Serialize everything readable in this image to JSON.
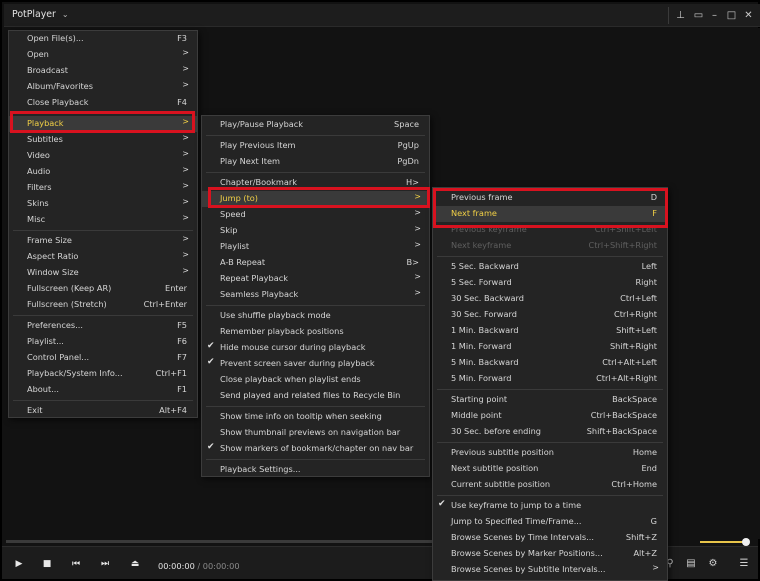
{
  "app": {
    "title": "PotPlayer"
  },
  "time": {
    "current": "00:00:00",
    "separator": "/",
    "total": "00:00:00"
  },
  "menu_main": [
    {
      "label": "Open File(s)...",
      "shortcut": "F3",
      "top": 0
    },
    {
      "label": "Open",
      "arrow": true
    },
    {
      "label": "Broadcast",
      "arrow": true
    },
    {
      "label": "Album/Favorites",
      "arrow": true
    },
    {
      "label": "Close Playback",
      "shortcut": "F4"
    },
    {
      "sep": true
    },
    {
      "label": "Playback",
      "arrow": true,
      "highlight": true
    },
    {
      "label": "Subtitles",
      "arrow": true
    },
    {
      "label": "Video",
      "arrow": true
    },
    {
      "label": "Audio",
      "arrow": true
    },
    {
      "label": "Filters",
      "arrow": true
    },
    {
      "label": "Skins",
      "arrow": true
    },
    {
      "label": "Misc",
      "arrow": true
    },
    {
      "sep": true
    },
    {
      "label": "Frame Size",
      "arrow": true
    },
    {
      "label": "Aspect Ratio",
      "arrow": true
    },
    {
      "label": "Window Size",
      "arrow": true
    },
    {
      "label": "Fullscreen (Keep AR)",
      "shortcut": "Enter"
    },
    {
      "label": "Fullscreen (Stretch)",
      "shortcut": "Ctrl+Enter"
    },
    {
      "sep": true
    },
    {
      "label": "Preferences...",
      "shortcut": "F5"
    },
    {
      "label": "Playlist...",
      "shortcut": "F6"
    },
    {
      "label": "Control Panel...",
      "shortcut": "F7"
    },
    {
      "label": "Playback/System Info...",
      "shortcut": "Ctrl+F1"
    },
    {
      "label": "About...",
      "shortcut": "F1"
    },
    {
      "sep": true
    },
    {
      "label": "Exit",
      "shortcut": "Alt+F4"
    }
  ],
  "menu_playback": [
    {
      "label": "Play/Pause Playback",
      "shortcut": "Space"
    },
    {
      "sep": true
    },
    {
      "label": "Play Previous Item",
      "shortcut": "PgUp"
    },
    {
      "label": "Play Next Item",
      "shortcut": "PgDn"
    },
    {
      "sep": true
    },
    {
      "label": "Chapter/Bookmark",
      "shortcut": "H>"
    },
    {
      "label": "Jump (to)",
      "arrow": true,
      "highlight": true
    },
    {
      "label": "Speed",
      "arrow": true
    },
    {
      "label": "Skip",
      "arrow": true
    },
    {
      "label": "Playlist",
      "arrow": true
    },
    {
      "label": "A-B Repeat",
      "shortcut": "B>"
    },
    {
      "label": "Repeat Playback",
      "arrow": true
    },
    {
      "label": "Seamless Playback",
      "arrow": true
    },
    {
      "sep": true
    },
    {
      "label": "Use shuffle playback mode"
    },
    {
      "label": "Remember playback positions"
    },
    {
      "label": "Hide mouse cursor during playback",
      "checked": true
    },
    {
      "label": "Prevent screen saver during playback",
      "checked": true
    },
    {
      "label": "Close playback when playlist ends"
    },
    {
      "label": "Send played and related files to Recycle Bin"
    },
    {
      "sep": true
    },
    {
      "label": "Show time info on tooltip when seeking"
    },
    {
      "label": "Show thumbnail previews on navigation bar"
    },
    {
      "label": "Show markers of bookmark/chapter on nav bar",
      "checked": true
    },
    {
      "sep": true
    },
    {
      "label": "Playback Settings..."
    }
  ],
  "menu_jump": [
    {
      "label": "Previous frame",
      "shortcut": "D"
    },
    {
      "label": "Next frame",
      "shortcut": "F",
      "highlight": true
    },
    {
      "label": "Previous keyframe",
      "shortcut": "Ctrl+Shift+Left",
      "disabled": true
    },
    {
      "label": "Next keyframe",
      "shortcut": "Ctrl+Shift+Right",
      "disabled": true
    },
    {
      "sep": true
    },
    {
      "label": "5 Sec. Backward",
      "shortcut": "Left"
    },
    {
      "label": "5 Sec. Forward",
      "shortcut": "Right"
    },
    {
      "label": "30 Sec. Backward",
      "shortcut": "Ctrl+Left"
    },
    {
      "label": "30 Sec. Forward",
      "shortcut": "Ctrl+Right"
    },
    {
      "label": "1 Min. Backward",
      "shortcut": "Shift+Left"
    },
    {
      "label": "1 Min. Forward",
      "shortcut": "Shift+Right"
    },
    {
      "label": "5 Min. Backward",
      "shortcut": "Ctrl+Alt+Left"
    },
    {
      "label": "5 Min. Forward",
      "shortcut": "Ctrl+Alt+Right"
    },
    {
      "sep": true
    },
    {
      "label": "Starting point",
      "shortcut": "BackSpace"
    },
    {
      "label": "Middle point",
      "shortcut": "Ctrl+BackSpace"
    },
    {
      "label": "30 Sec. before ending",
      "shortcut": "Shift+BackSpace"
    },
    {
      "sep": true
    },
    {
      "label": "Previous subtitle position",
      "shortcut": "Home"
    },
    {
      "label": "Next subtitle position",
      "shortcut": "End"
    },
    {
      "label": "Current subtitle position",
      "shortcut": "Ctrl+Home"
    },
    {
      "sep": true
    },
    {
      "label": "Use keyframe to jump to a time",
      "checked": true
    },
    {
      "label": "Jump to Specified Time/Frame...",
      "shortcut": "G"
    },
    {
      "label": "Browse Scenes by Time Intervals...",
      "shortcut": "Shift+Z"
    },
    {
      "label": "Browse Scenes by Marker Positions...",
      "shortcut": "Alt+Z"
    },
    {
      "label": "Browse Scenes by Subtitle Intervals...",
      "arrow": true
    }
  ],
  "icons": {
    "pin": "pin-icon",
    "compact": "compact-mode-icon",
    "minimize": "minimize-icon",
    "maximize": "maximize-icon",
    "close": "close-icon"
  },
  "colors": {
    "highlight_text": "#f2d046",
    "redbox": "#d8121f",
    "volume": "#e8c54a"
  }
}
